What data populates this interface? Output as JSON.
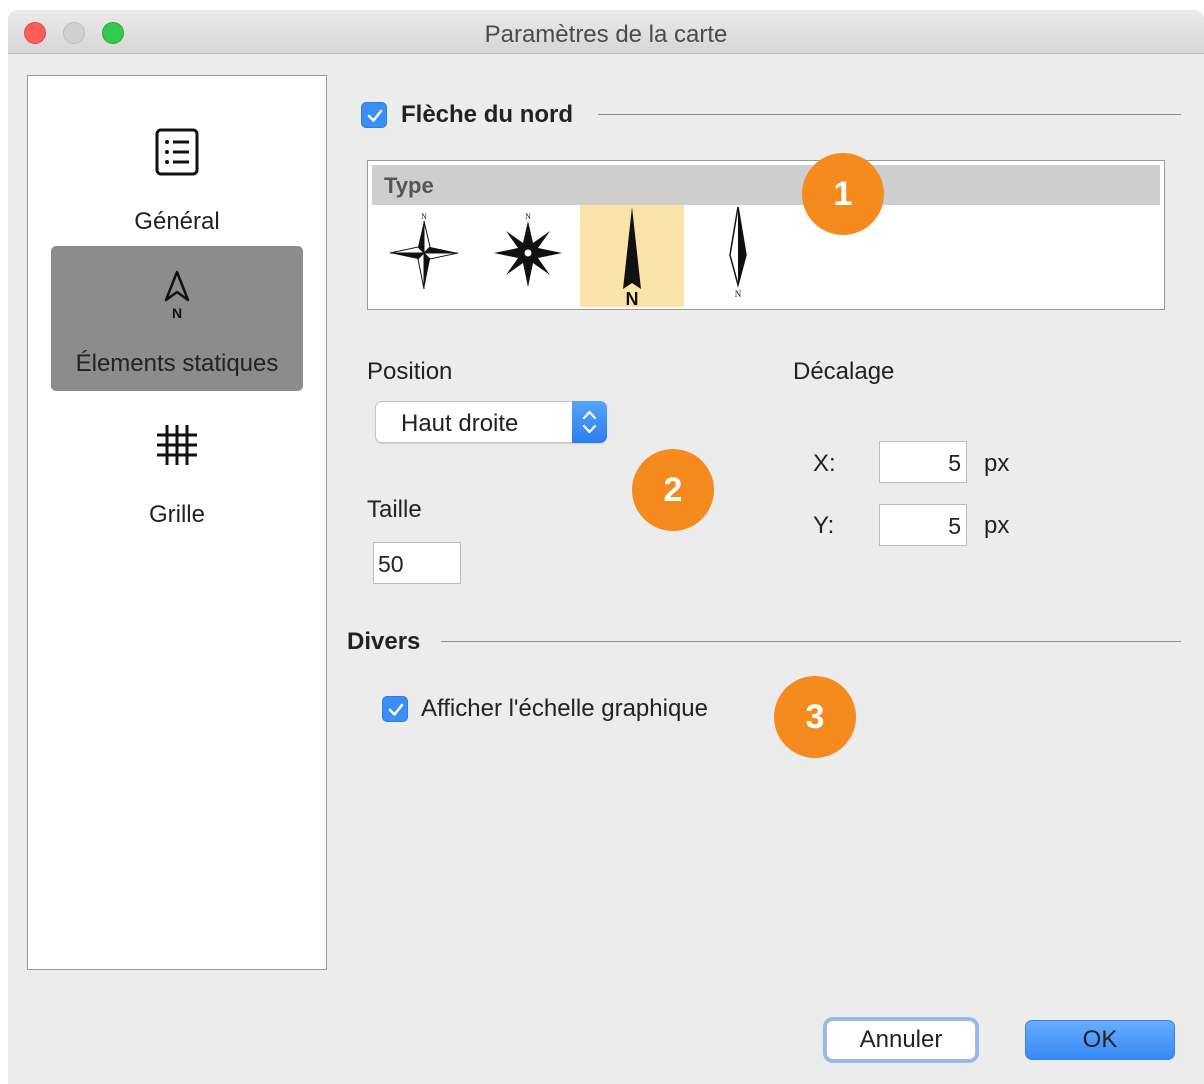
{
  "window": {
    "title": "Paramètres de la carte"
  },
  "sidebar": {
    "items": [
      {
        "label": "Général",
        "icon": "list-icon",
        "selected": false
      },
      {
        "label": "Élements statiques",
        "icon": "north-arrow-icon",
        "selected": true
      },
      {
        "label": "Grille",
        "icon": "grid-icon",
        "selected": false
      }
    ]
  },
  "north_arrow": {
    "checkbox_label": "Flèche du nord",
    "checked": true,
    "type_header": "Type",
    "types": [
      {
        "name": "compass-rose-4-point",
        "selected": false
      },
      {
        "name": "compass-rose-8-point",
        "selected": false
      },
      {
        "name": "black-north-arrow",
        "selected": true
      },
      {
        "name": "slim-north-arrow",
        "selected": false
      }
    ],
    "position_label": "Position",
    "position_value": "Haut droite",
    "size_label": "Taille",
    "size_value": "50",
    "offset_label": "Décalage",
    "x_label": "X:",
    "x_value": "5",
    "y_label": "Y:",
    "y_value": "5",
    "unit": "px"
  },
  "misc": {
    "title": "Divers",
    "scale_label": "Afficher l'échelle graphique",
    "scale_checked": true
  },
  "badges": {
    "one": "1",
    "two": "2",
    "three": "3"
  },
  "buttons": {
    "cancel": "Annuler",
    "ok": "OK"
  },
  "colors": {
    "accent": "#3a8ef5",
    "badge": "#f58b1f",
    "selected_type": "#f9e3a8",
    "sidebar_selected": "#8c8c8c"
  }
}
